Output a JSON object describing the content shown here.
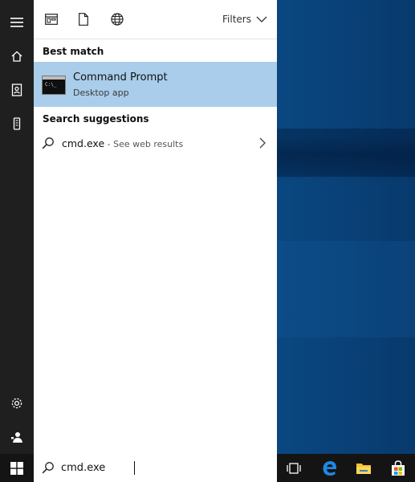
{
  "header": {
    "filters_label": "Filters"
  },
  "best_match": {
    "section_title": "Best match",
    "title": "Command Prompt",
    "subtitle": "Desktop app"
  },
  "suggestions": {
    "section_title": "Search suggestions",
    "items": [
      {
        "query": "cmd.exe",
        "suffix": " - See web results"
      }
    ]
  },
  "search": {
    "value": "cmd.exe"
  },
  "colors": {
    "highlight": "#a9cdea",
    "rail": "#1f1f1f",
    "taskbar": "#141414",
    "edge_blue": "#1e88e5"
  },
  "icons": {
    "rail": [
      "hamburger-icon",
      "home-icon",
      "notebook-icon",
      "device-icon",
      "settings-icon",
      "user-feedback-icon"
    ],
    "header": [
      "apps-icon",
      "documents-icon",
      "web-icon"
    ],
    "taskbar": [
      "windows-start-icon",
      "search-icon",
      "task-view-icon",
      "edge-icon",
      "file-explorer-icon",
      "store-icon"
    ]
  }
}
